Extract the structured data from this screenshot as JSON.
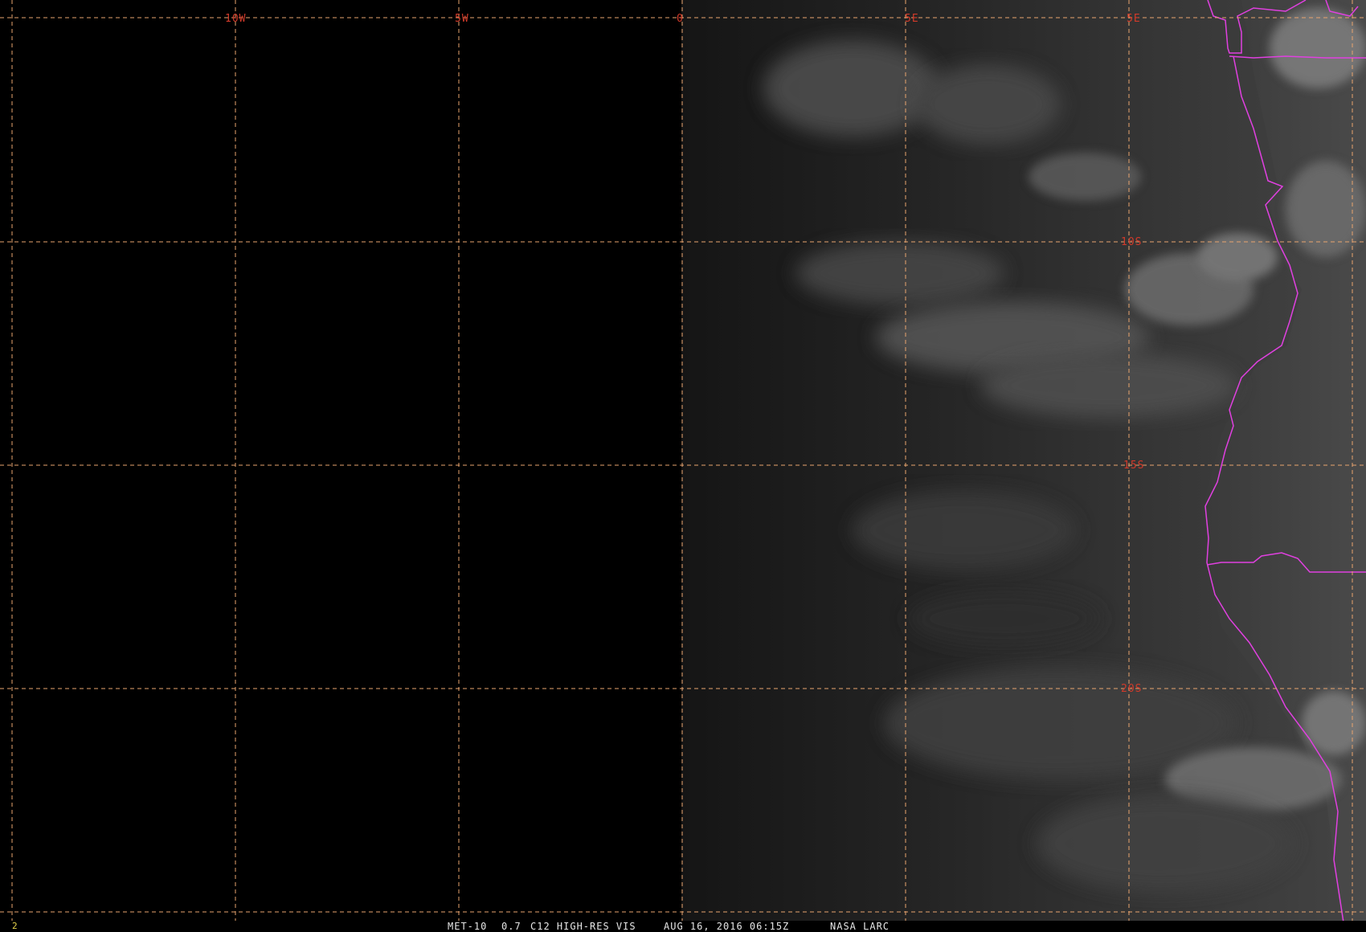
{
  "product": {
    "satellite": "MET-10",
    "channel": "0.7",
    "band": "C12 HIGH-RES VIS",
    "datetime": "AUG 16, 2016 06:15Z",
    "source": "NASA LARC",
    "frame_number": "2"
  },
  "grid": {
    "longitude_labels": [
      "10W",
      "5W",
      "0",
      "5E",
      "5E"
    ],
    "latitude_labels": [
      "10S",
      "15S",
      "20S"
    ],
    "line_color": "#e8a46e",
    "label_color": "#d23a2a"
  },
  "boundaries": {
    "color": "#e040e0"
  },
  "colors": {
    "background": "#000000",
    "footer_text": "#e6e6e6",
    "frame_number": "#e8d44d"
  }
}
